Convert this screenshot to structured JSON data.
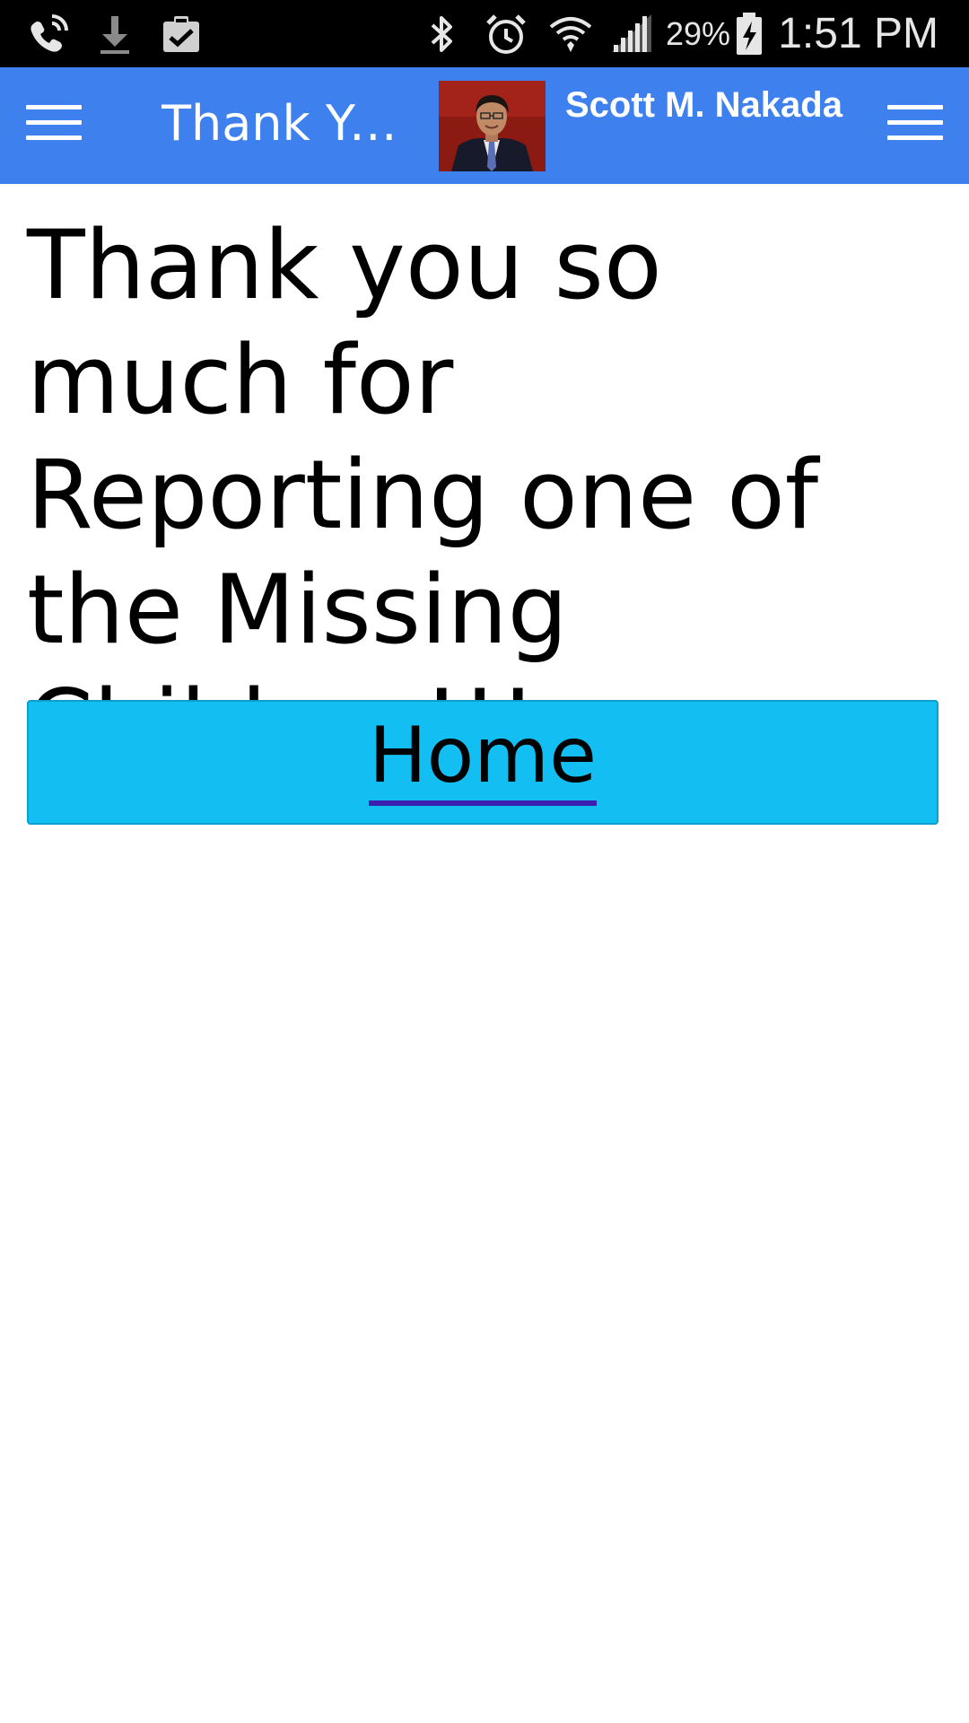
{
  "status_bar": {
    "battery_percent": "29%",
    "time": "1:51 PM",
    "icons": [
      "wifi-calling-icon",
      "download-icon",
      "clipboard-check-icon",
      "bluetooth-icon",
      "alarm-icon",
      "wifi-icon",
      "signal-icon",
      "battery-charging-icon"
    ]
  },
  "app_bar": {
    "title": "Thank Yo...",
    "user_name": "Scott M. Nakada",
    "color": "#3d80ee"
  },
  "main": {
    "message": "Thank you so much for Reporting one of the Missing Children!!!",
    "home_button": {
      "label": "Home",
      "color": "#13bff2"
    }
  }
}
